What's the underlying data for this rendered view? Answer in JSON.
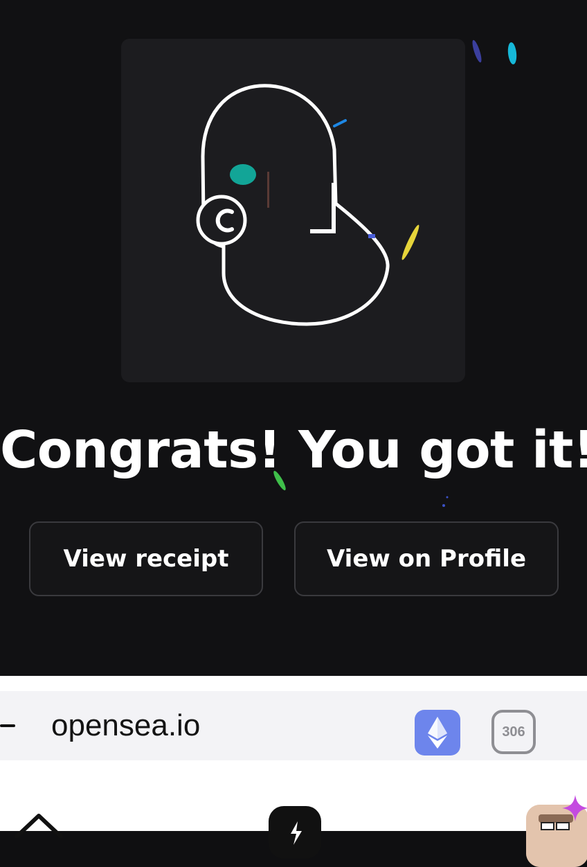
{
  "headline": "Congrats! You got it!",
  "buttons": {
    "receipt": "View receipt",
    "profile": "View on Profile"
  },
  "browser": {
    "url": "opensea.io",
    "tab_count": "306",
    "icons": {
      "ethereum": "ethereum-icon",
      "home": "home-icon",
      "center": "app-icon",
      "avatar": "profile-avatar"
    }
  },
  "colors": {
    "background": "#111113",
    "card": "#1c1c1f",
    "ethereum_button": "#6d85ec",
    "teal_confetti": "#12a597",
    "yellow_confetti": "#e6d43a"
  }
}
